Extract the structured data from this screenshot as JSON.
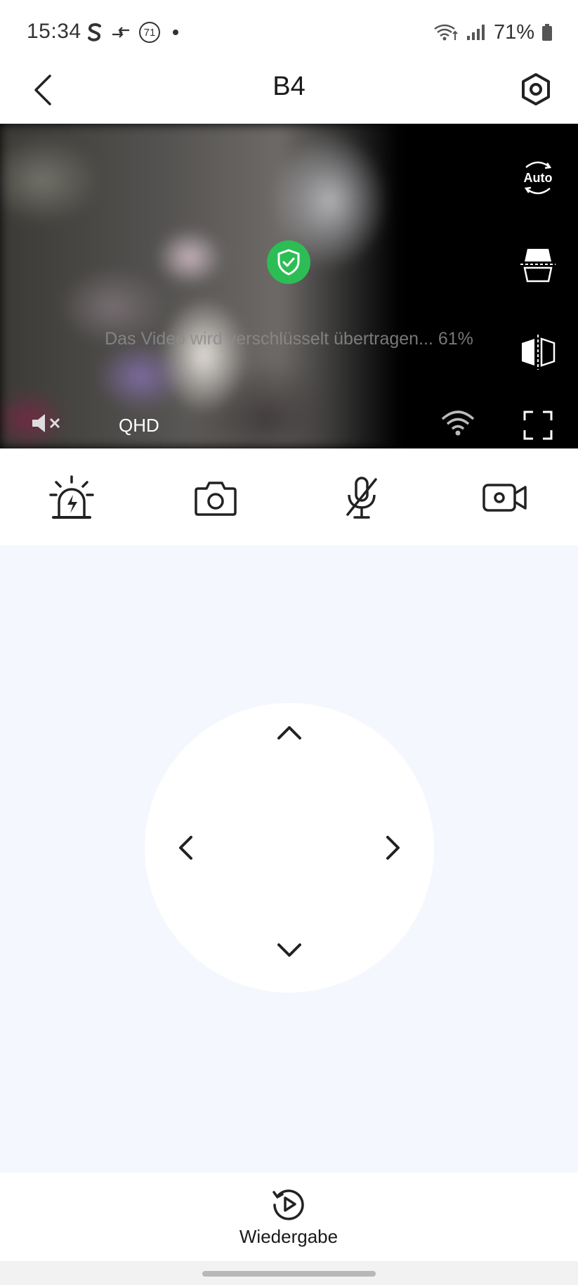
{
  "status_bar": {
    "time": "15:34",
    "notification_badge": "71",
    "battery": "71%",
    "icons_left": [
      "s-app-icon",
      "data-transfer-icon",
      "badge-71-icon",
      "dot-icon"
    ],
    "icons_right": [
      "wifi-icon",
      "signal-icon",
      "battery-icon"
    ]
  },
  "header": {
    "title": "B4",
    "back_icon": "chevron-left-icon",
    "settings_icon": "hexagon-settings-icon"
  },
  "video": {
    "status_text": "Das Video wird verschlüsselt übertragen... 61%",
    "quality": "QHD",
    "auto_label": "Auto",
    "shield_color": "#2dbd55",
    "side_controls": [
      "auto-rotate-icon",
      "flip-vertical-icon",
      "mirror-horizontal-icon"
    ],
    "bottom_controls": [
      "mute-icon",
      "wifi-icon",
      "fullscreen-icon"
    ]
  },
  "actions": [
    {
      "name": "siren-button",
      "icon": "siren-icon"
    },
    {
      "name": "snapshot-button",
      "icon": "camera-icon"
    },
    {
      "name": "microphone-button",
      "icon": "mic-off-icon"
    },
    {
      "name": "record-button",
      "icon": "video-camera-icon"
    }
  ],
  "ptz": {
    "directions": [
      "up",
      "left",
      "right",
      "down"
    ]
  },
  "bottom": {
    "playback_label": "Wiedergabe",
    "playback_icon": "replay-icon"
  }
}
